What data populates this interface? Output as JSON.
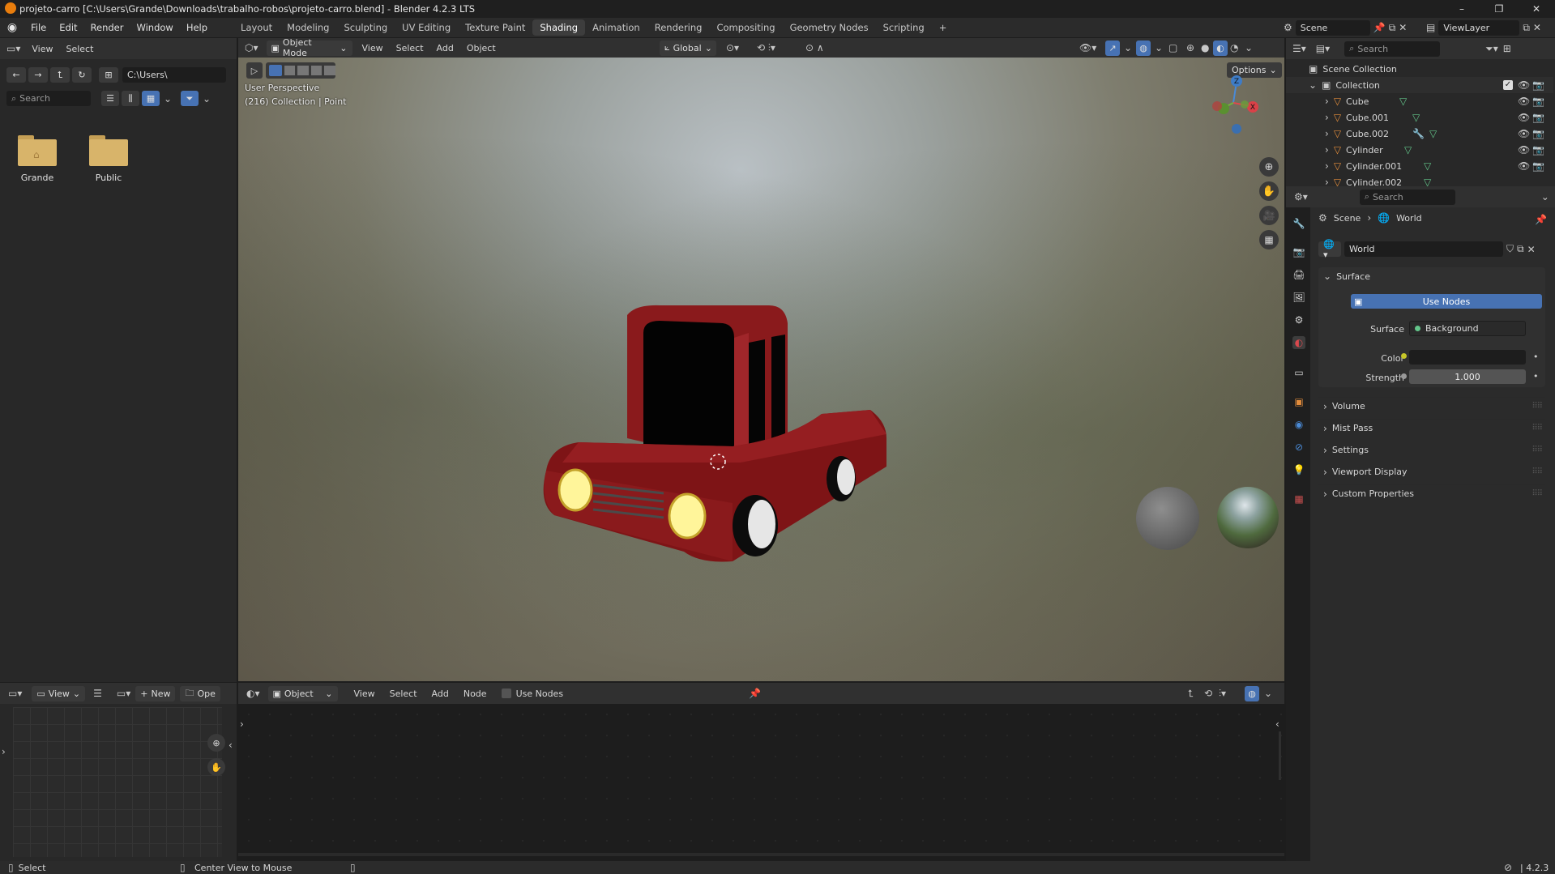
{
  "window": {
    "title": "projeto-carro [C:\\Users\\Grande\\Downloads\\trabalho-robos\\projeto-carro.blend] - Blender 4.2.3 LTS",
    "controls": [
      "–",
      "❐",
      "✕"
    ]
  },
  "menu": {
    "items": [
      "File",
      "Edit",
      "Render",
      "Window",
      "Help"
    ],
    "workspaces": [
      "Layout",
      "Modeling",
      "Sculpting",
      "UV Editing",
      "Texture Paint",
      "Shading",
      "Animation",
      "Rendering",
      "Compositing",
      "Geometry Nodes",
      "Scripting"
    ],
    "active_workspace": "Shading",
    "add_workspace": "+",
    "scene": "Scene",
    "view_layer": "ViewLayer"
  },
  "file_browser": {
    "menu": [
      "View",
      "Select"
    ],
    "path": "C:\\Users\\",
    "search_placeholder": "Search",
    "folders": [
      "Grande",
      "Public"
    ]
  },
  "viewport": {
    "mode": "Object Mode",
    "menu": [
      "View",
      "Select",
      "Add",
      "Object"
    ],
    "transform": "Global",
    "options": "Options",
    "overlay_line1": "User Perspective",
    "overlay_line2": "(216) Collection | Point",
    "gizmo_axes": [
      "Z",
      "X"
    ]
  },
  "outliner": {
    "search_placeholder": "Search",
    "root": "Scene Collection",
    "collection": "Collection",
    "objects": [
      "Cube",
      "Cube.001",
      "Cube.002",
      "Cylinder",
      "Cylinder.001",
      "Cylinder.002"
    ]
  },
  "properties": {
    "search_placeholder": "Search",
    "breadcrumb": [
      "Scene",
      "World"
    ],
    "world_name": "World",
    "surface_header": "Surface",
    "use_nodes": "Use Nodes",
    "surface_label": "Surface",
    "surface_value": "Background",
    "color_label": "Color",
    "strength_label": "Strength",
    "strength_value": "1.000",
    "sections": [
      "Volume",
      "Mist Pass",
      "Settings",
      "Viewport Display",
      "Custom Properties"
    ]
  },
  "image_editor": {
    "view": "View",
    "new": "New",
    "open": "Ope"
  },
  "shader_editor": {
    "object": "Object",
    "menu": [
      "View",
      "Select",
      "Add",
      "Node"
    ],
    "use_nodes": "Use Nodes"
  },
  "statusbar": {
    "select": "Select",
    "center_view": "Center View to Mouse",
    "version": "4.2.3"
  },
  "colors": {
    "accent_blue": "#4772b3",
    "car_red": "#8a1a1c",
    "folder": "#d8b46a",
    "mesh_icon": "#e38d3c",
    "data_icon": "#63c58a"
  }
}
